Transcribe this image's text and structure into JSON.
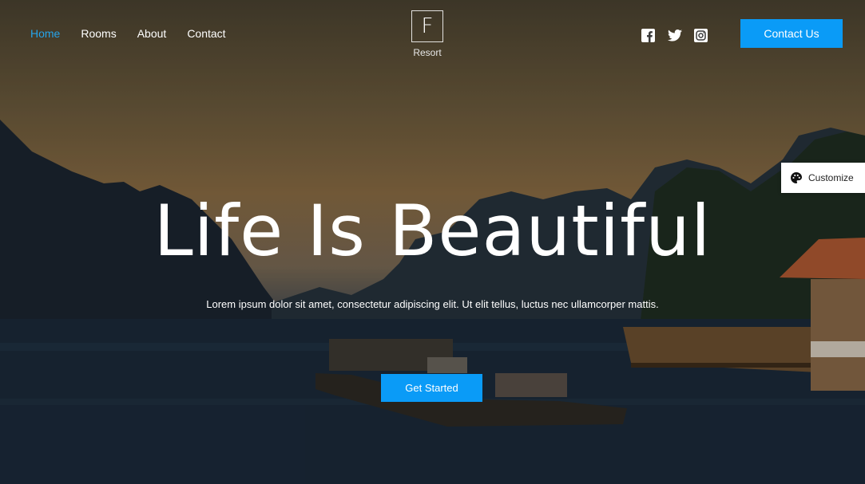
{
  "nav": {
    "items": [
      {
        "label": "Home",
        "active": true
      },
      {
        "label": "Rooms",
        "active": false
      },
      {
        "label": "About",
        "active": false
      },
      {
        "label": "Contact",
        "active": false
      }
    ]
  },
  "logo": {
    "mark": "F",
    "name": "Resort"
  },
  "social": {
    "icons": [
      "facebook-icon",
      "twitter-icon",
      "instagram-icon"
    ]
  },
  "header": {
    "contact_button": "Contact Us"
  },
  "customize": {
    "label": "Customize",
    "icon": "palette-icon"
  },
  "hero": {
    "title": "Life Is Beautiful",
    "subtitle": "Lorem ipsum dolor sit amet, consectetur adipiscing elit. Ut elit tellus, luctus nec ullamcorper mattis.",
    "cta_label": "Get Started"
  },
  "colors": {
    "accent": "#0a9bf7",
    "active_nav": "#26a4ea"
  }
}
